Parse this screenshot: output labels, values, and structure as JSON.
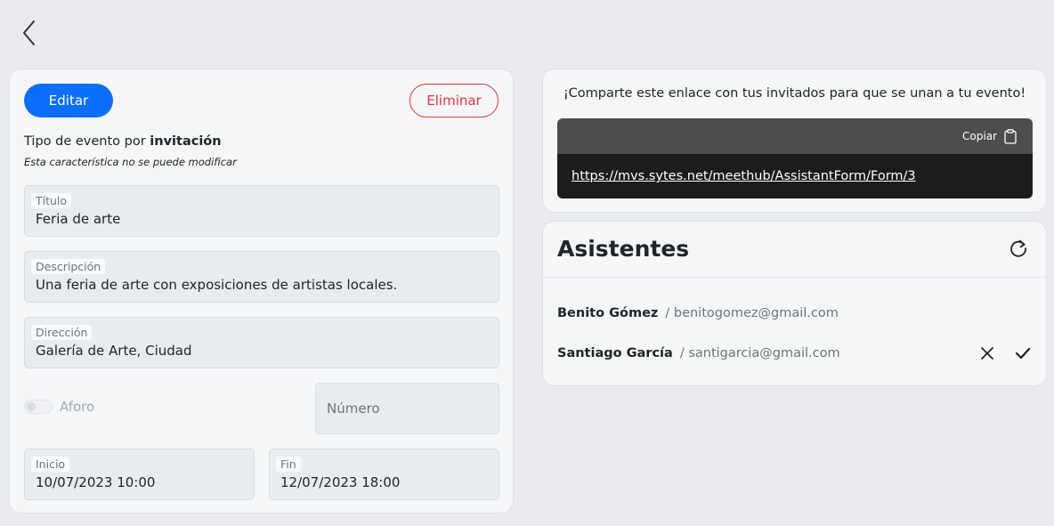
{
  "event": {
    "edit_label": "Editar",
    "delete_label": "Eliminar",
    "type_prefix": "Tipo de evento por",
    "type_value": "invitación",
    "type_note": "Esta característica no se puede modificar",
    "fields": {
      "title": {
        "label": "Título",
        "value": "Feria de arte"
      },
      "description": {
        "label": "Descripción",
        "value": "Una feria de arte con exposiciones de artistas locales."
      },
      "address": {
        "label": "Dirección",
        "value": "Galería de Arte, Ciudad"
      },
      "start": {
        "label": "Inicio",
        "value": "10/07/2023 10:00"
      },
      "end": {
        "label": "Fin",
        "value": "12/07/2023 18:00"
      }
    },
    "capacity": {
      "toggle_label": "Aforo",
      "enabled": false,
      "number_placeholder": "Número"
    }
  },
  "share": {
    "message": "¡Comparte este enlace con tus invitados para que se unan a tu evento!",
    "copy_label": "Copiar",
    "link": "https://mvs.sytes.net/meethub/AssistantForm/Form/3"
  },
  "attendees": {
    "title": "Asistentes",
    "items": [
      {
        "name": "Benito Gómez",
        "email": "/ benitogomez@gmail.com"
      },
      {
        "name": "Santiago García",
        "email": "/ santigarcia@gmail.com"
      }
    ]
  },
  "colors": {
    "primary": "#0d6efd",
    "danger": "#dc3545",
    "background": "#e9eaed",
    "card": "#f5f6f8"
  }
}
